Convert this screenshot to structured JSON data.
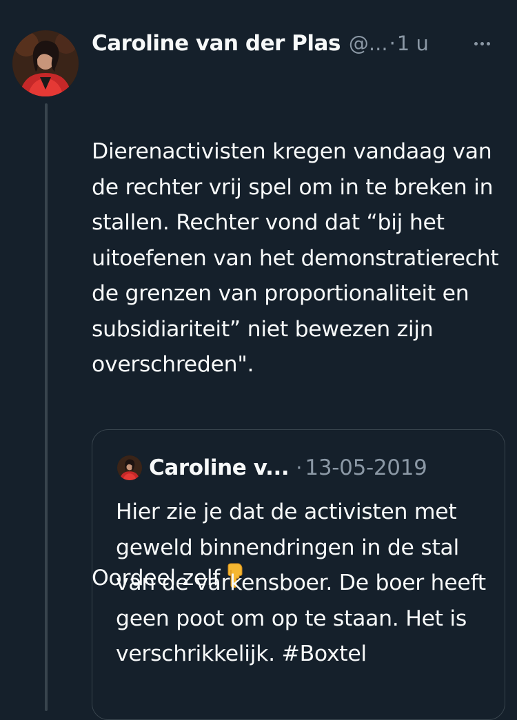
{
  "tweet": {
    "author_name": "Caroline van der Plas",
    "author_handle": "@...",
    "separator": "·",
    "timestamp": "1 u",
    "more_icon": "more-horizontal-icon",
    "text_paragraph_1": "Dierenactivisten kregen vandaag van de rechter vrij spel om in te breken in stallen. Rechter vond dat “bij het uitoefenen van het demonstratierecht de grenzen van proportionaliteit en subsidiariteit” niet bewezen zijn overschreden\".",
    "text_paragraph_2": "Oordeel zelf",
    "emoji": "backhand-index-pointing-down"
  },
  "quoted_tweet": {
    "author_name": "Caroline v...",
    "separator": "·",
    "date": "13-05-2019",
    "text": "Hier zie je dat de activisten met geweld binnendringen in de stal van de varkensboer. De boer heeft geen poot om op te staan. Het is verschrikkelijk. #Boxtel"
  },
  "colors": {
    "background": "#15202b",
    "primary_text": "#f7f9f9",
    "secondary_text": "#8b98a5",
    "border": "#38444d",
    "emoji_yellow": "#f5b731"
  }
}
